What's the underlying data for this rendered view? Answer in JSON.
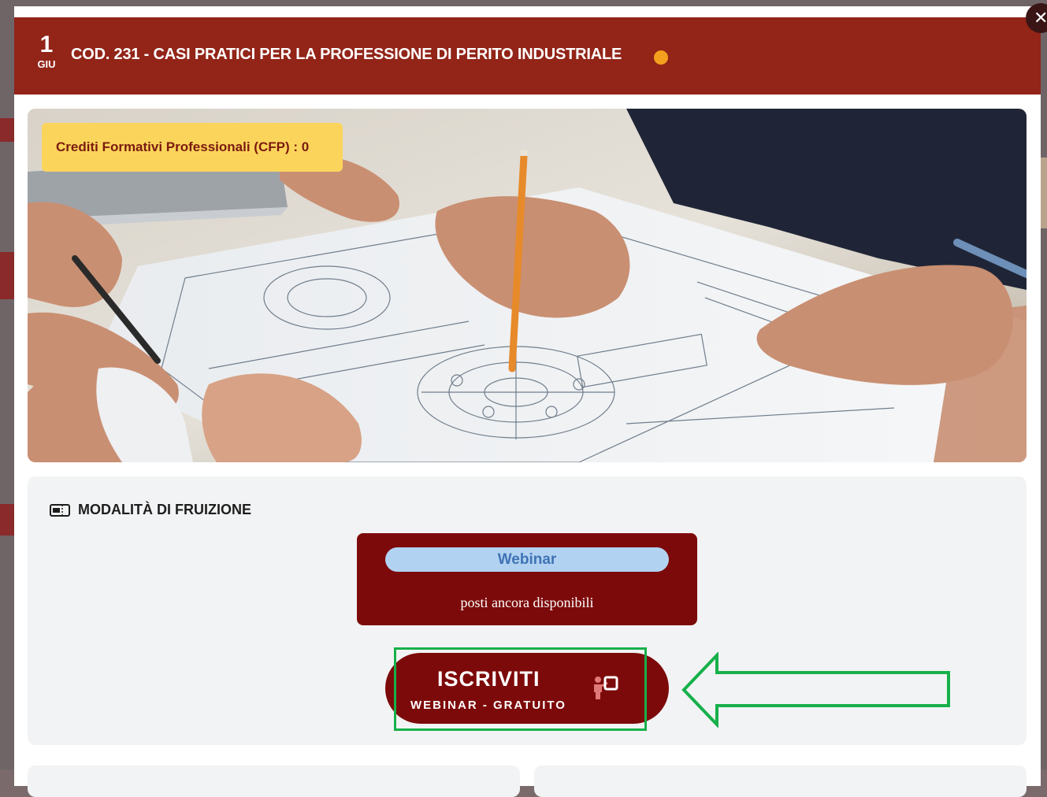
{
  "event": {
    "day": "1",
    "month": "GIU",
    "title": "COD. 231 - CASI PRATICI PER LA PROFESSIONE DI PERITO INDUSTRIALE",
    "status_color": "#f4a01e"
  },
  "close": {
    "label": "✕"
  },
  "hero": {
    "image_icon": "technical-drawing-photo",
    "cfp_label": "Crediti Formativi Professionali (CFP) : 0"
  },
  "fruizione": {
    "icon": "ticket-icon",
    "title": "MODALITÀ DI FRUIZIONE",
    "mode_label": "Webinar",
    "availability": "posti ancora disponibili"
  },
  "cta": {
    "main_label": "ISCRIVITI",
    "sub_label": "WEBINAR - GRATUITO",
    "icon": "enroll-person-icon"
  },
  "annotation": {
    "highlight_color": "#16b04a",
    "arrow_icon": "left-arrow-icon"
  },
  "colors": {
    "header_bg": "#922418",
    "card_bg": "#7d0a0a",
    "badge_bg": "#fbd55b",
    "pill_bg": "#b2d2f1"
  }
}
